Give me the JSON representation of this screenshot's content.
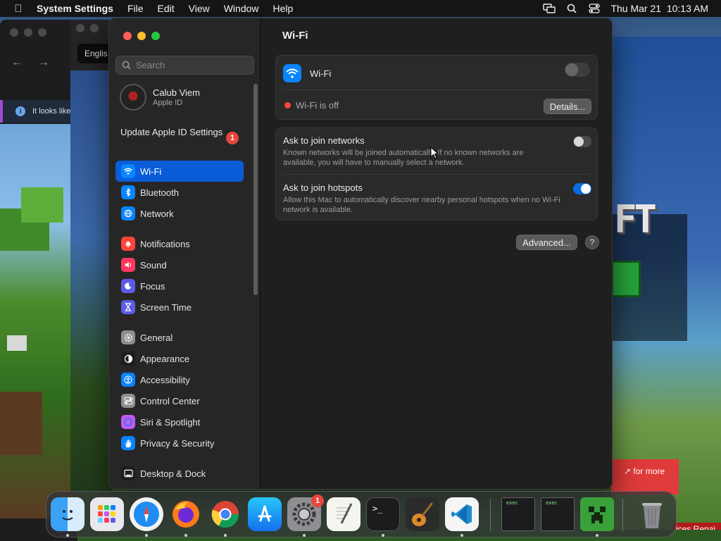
{
  "menubar": {
    "app_name": "System Settings",
    "menus": [
      "File",
      "Edit",
      "View",
      "Window",
      "Help"
    ],
    "clock": "Thu Mar 21  10:13 AM"
  },
  "background": {
    "browser_tab_label": "Englis",
    "info_text": "It looks like",
    "promo_text": "for more",
    "promo_text_2": "ices Repai"
  },
  "window": {
    "search_placeholder": "Search",
    "account": {
      "name": "Calub Viem",
      "subtitle": "Apple ID"
    },
    "update": {
      "label": "Update Apple ID Settings",
      "badge": "1"
    },
    "sidebar": {
      "group1": [
        {
          "label": "Wi-Fi",
          "icon": "wifi-icon",
          "color": "#0a84ff",
          "active": true
        },
        {
          "label": "Bluetooth",
          "icon": "bluetooth-icon",
          "color": "#0a84ff"
        },
        {
          "label": "Network",
          "icon": "globe-icon",
          "color": "#0a84ff"
        }
      ],
      "group2": [
        {
          "label": "Notifications",
          "icon": "bell-icon",
          "color": "#ff453a"
        },
        {
          "label": "Sound",
          "icon": "speaker-icon",
          "color": "#ff375f"
        },
        {
          "label": "Focus",
          "icon": "moon-icon",
          "color": "#5e5ce6"
        },
        {
          "label": "Screen Time",
          "icon": "hourglass-icon",
          "color": "#5e5ce6"
        }
      ],
      "group3": [
        {
          "label": "General",
          "icon": "gear-icon",
          "color": "#8e8e93"
        },
        {
          "label": "Appearance",
          "icon": "appearance-icon",
          "color": "#1c1c1e"
        },
        {
          "label": "Accessibility",
          "icon": "accessibility-icon",
          "color": "#0a84ff"
        },
        {
          "label": "Control Center",
          "icon": "control-center-icon",
          "color": "#8e8e93"
        },
        {
          "label": "Siri & Spotlight",
          "icon": "siri-icon",
          "color": "#bf5af2"
        },
        {
          "label": "Privacy & Security",
          "icon": "hand-icon",
          "color": "#0a84ff"
        }
      ],
      "group4": [
        {
          "label": "Desktop & Dock",
          "icon": "dock-icon",
          "color": "#1c1c1e"
        }
      ]
    },
    "main": {
      "title": "Wi-Fi",
      "wifi_label": "Wi-Fi",
      "wifi_on": false,
      "status": "Wi-Fi is off",
      "details_button": "Details...",
      "ask_networks": {
        "title": "Ask to join networks",
        "desc": "Known networks will be joined automatically. If no known networks are available, you will have to manually select a network.",
        "on": false
      },
      "ask_hotspots": {
        "title": "Ask to join hotspots",
        "desc": "Allow this Mac to automatically discover nearby personal hotspots when no Wi-Fi network is available.",
        "on": true
      },
      "advanced_button": "Advanced...",
      "help_button": "?"
    }
  },
  "dock": {
    "settings_badge": "1",
    "exec_label": "exec",
    "apps": [
      "Finder",
      "Launchpad",
      "Safari",
      "Firefox",
      "Chrome",
      "App Store",
      "System Settings",
      "TextEdit",
      "Terminal",
      "GarageBand",
      "VS Code",
      "exec",
      "exec",
      "Minecraft",
      "Trash"
    ]
  }
}
